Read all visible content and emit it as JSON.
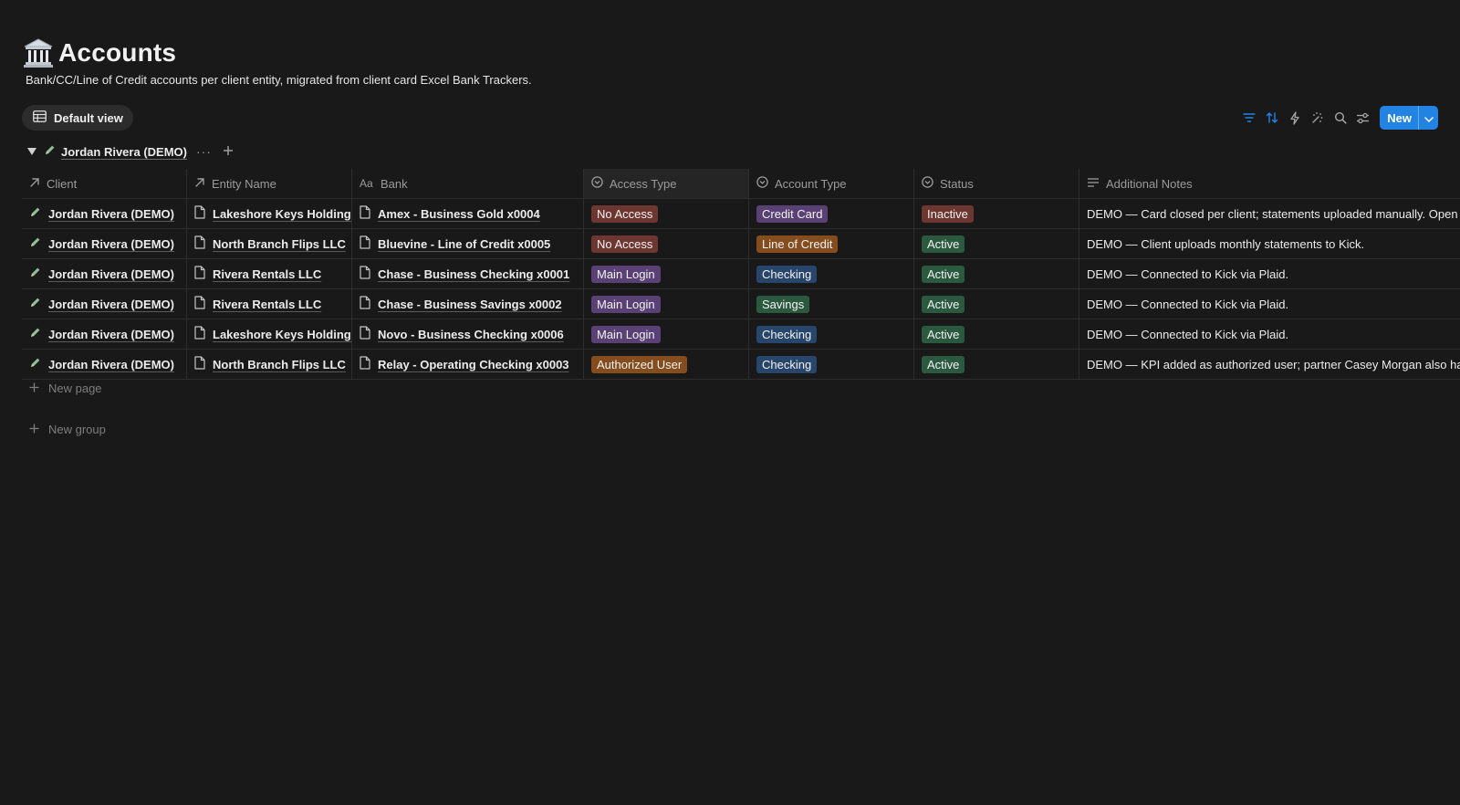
{
  "page": {
    "icon": "bank-building-icon",
    "title": "Accounts",
    "description": "Bank/CC/Line of Credit accounts per client entity, migrated from client card Excel Bank Trackers."
  },
  "view": {
    "label": "Default view",
    "icon": "table-icon"
  },
  "toolbar": {
    "icons": [
      "filter-icon",
      "sort-icon",
      "automation-icon",
      "ai-sparkle-icon",
      "search-icon",
      "view-settings-icon"
    ],
    "new_label": "New",
    "accent": "#2383e2"
  },
  "group": {
    "label": "Jordan Rivera (DEMO)"
  },
  "columns": [
    {
      "label": "Client",
      "icon": "relation-arrow-icon"
    },
    {
      "label": "Entity Name",
      "icon": "relation-arrow-icon"
    },
    {
      "label": "Bank",
      "icon": "title-text-icon"
    },
    {
      "label": "Access Type",
      "icon": "select-icon"
    },
    {
      "label": "Account Type",
      "icon": "select-icon"
    },
    {
      "label": "Status",
      "icon": "select-icon"
    },
    {
      "label": "Additional Notes",
      "icon": "text-lines-icon"
    }
  ],
  "tag_colors": {
    "red": "#6e3630",
    "purple": "#5a4175",
    "orange": "#854c1d",
    "blue": "#28456c",
    "green": "#2b593f"
  },
  "rows": [
    {
      "client": "Jordan Rivera (DEMO)",
      "entity": "Lakeshore Keys Holdings LLC",
      "bank": "Amex - Business Gold x0004",
      "access": "No Access",
      "access_color": "red",
      "account_type": "Credit Card",
      "account_color": "purple",
      "status": "Inactive",
      "status_color": "red",
      "notes": "DEMO — Card closed per client; statements uploaded manually. Open items"
    },
    {
      "client": "Jordan Rivera (DEMO)",
      "entity": "North Branch Flips LLC",
      "bank": "Bluevine - Line of Credit x0005",
      "access": "No Access",
      "access_color": "red",
      "account_type": "Line of Credit",
      "account_color": "orange",
      "status": "Active",
      "status_color": "green",
      "notes": "DEMO — Client uploads monthly statements to Kick."
    },
    {
      "client": "Jordan Rivera (DEMO)",
      "entity": "Rivera Rentals LLC",
      "bank": "Chase - Business Checking x0001",
      "access": "Main Login",
      "access_color": "purple",
      "account_type": "Checking",
      "account_color": "blue",
      "status": "Active",
      "status_color": "green",
      "notes": "DEMO — Connected to Kick via Plaid."
    },
    {
      "client": "Jordan Rivera (DEMO)",
      "entity": "Rivera Rentals LLC",
      "bank": "Chase - Business Savings x0002",
      "access": "Main Login",
      "access_color": "purple",
      "account_type": "Savings",
      "account_color": "green",
      "status": "Active",
      "status_color": "green",
      "notes": "DEMO — Connected to Kick via Plaid."
    },
    {
      "client": "Jordan Rivera (DEMO)",
      "entity": "Lakeshore Keys Holdings LLC",
      "bank": "Novo - Business Checking x0006",
      "access": "Main Login",
      "access_color": "purple",
      "account_type": "Checking",
      "account_color": "blue",
      "status": "Active",
      "status_color": "green",
      "notes": "DEMO — Connected to Kick via Plaid."
    },
    {
      "client": "Jordan Rivera (DEMO)",
      "entity": "North Branch Flips LLC",
      "bank": "Relay - Operating Checking x0003",
      "access": "Authorized User",
      "access_color": "orange",
      "account_type": "Checking",
      "account_color": "blue",
      "status": "Active",
      "status_color": "green",
      "notes": "DEMO — KPI added as authorized user; partner Casey Morgan also has access."
    }
  ],
  "new_page_label": "New page",
  "new_group_label": "New group"
}
